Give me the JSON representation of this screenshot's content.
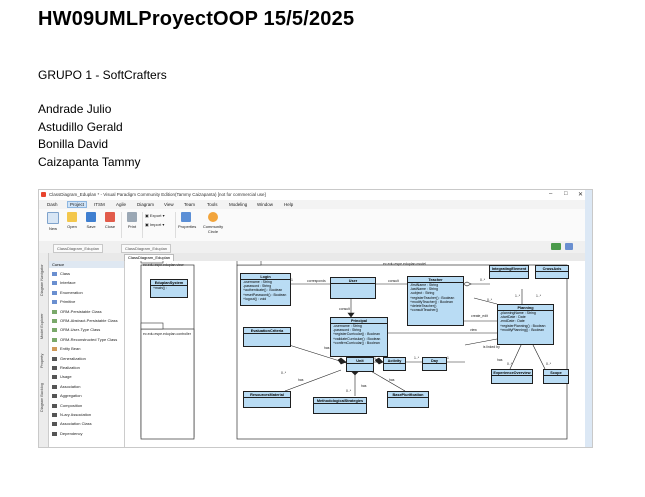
{
  "document": {
    "title": "HW09UMLProyectOOP  15/5/2025",
    "group": "GRUPO 1 - SoftCrafters",
    "members": [
      "Andrade Julio",
      "Astudillo Gerald",
      "Bonilla David",
      "Caizapanta Tammy"
    ]
  },
  "screenshot": {
    "window_title": "ClassDiagram_Eduplan * - Visual Paradigm Community Edition(Tammy Caizapanta) [not for commercial use]",
    "menu": [
      "Dash",
      "Project",
      "ITSM",
      "Agile",
      "Diagram",
      "View",
      "Team",
      "Tools",
      "Modeling",
      "Window",
      "Help"
    ],
    "active_menu": "Project",
    "ribbon": {
      "new": "New",
      "open": "Open",
      "save": "Save",
      "close": "Close",
      "print": "Print",
      "export": "Export",
      "import": "Import",
      "properties": "Properties",
      "community": "Community Circle"
    },
    "breadcrumbs": [
      "ClassDiagram_Eduplan",
      "ClassDiagram_Eduplan"
    ],
    "tab": "ClassDiagram_Eduplan",
    "side_tabs": [
      "Diagram Navigator",
      "Model Explorer",
      "Property",
      "Diagram Backlog"
    ],
    "palette": {
      "header": "Cursor",
      "items": [
        "Class",
        "Interface",
        "Enumeration",
        "Primitive",
        "ORM-Persistable Class",
        "ORM-Abstract-Persistable Class",
        "ORM-User-Type Class",
        "ORM-Reconstructed Type Class",
        "Entity Bean",
        "Generalization",
        "Realization",
        "Usage",
        "Association",
        "Aggregation",
        "Composition",
        "N-ary Association",
        "Association Class",
        "Dependency"
      ]
    },
    "diagram": {
      "package_main": "ec.edu.espe.eduplan.model",
      "package_view": "ec.edu.espe.eduplan.view",
      "package_controller": "ec.edu.espe.eduplan.controller",
      "classes": {
        "eduplan_system": {
          "name": "EduplanSystem",
          "attrs": [
            "+main() : "
          ]
        },
        "login": {
          "name": "Login",
          "attrs": [
            "-username : String",
            "-password : String",
            "+authenticate() : Boolean",
            "+resetPassword() : Boolean",
            "+logout() : void"
          ]
        },
        "user": {
          "name": "User",
          "attrs": []
        },
        "teacher": {
          "name": "Teacher",
          "attrs": [
            "-firstName : String",
            "-lastName : String",
            "-subject : String",
            "+registerTeacher() : Boolean",
            "+modifyTeacher() : Boolean",
            "+deleteTeacher()",
            "+consultTeacher()"
          ]
        },
        "integrating_element": {
          "name": "IntegratingElement",
          "attrs": []
        },
        "cross_axis": {
          "name": "CrossAxis",
          "attrs": []
        },
        "planning": {
          "name": "Planning",
          "attrs": [
            "-planningName : String",
            "-startDate : Date",
            "-endDate : Date",
            "+registerPlanning() : Boolean",
            "+modifyPlanning() : Boolean"
          ]
        },
        "principal": {
          "name": "Principal",
          "attrs": [
            "-username : String",
            "-password : String",
            "+registerCurricular() : Boolean",
            "+validateCurricular() : Boolean",
            "+confirmCurricular() : Boolean"
          ]
        },
        "evaluation_criteria": {
          "name": "EvaluationCriteria",
          "attrs": []
        },
        "unit": {
          "name": "Unit",
          "attrs": []
        },
        "activity": {
          "name": "Activity",
          "attrs": []
        },
        "day": {
          "name": "Day",
          "attrs": []
        },
        "experience_overview": {
          "name": "ExperienceOverview",
          "attrs": []
        },
        "scope": {
          "name": "Scope",
          "attrs": []
        },
        "resources_material": {
          "name": "ResourcesMaterial",
          "attrs": []
        },
        "methodological_strategies": {
          "name": "MethodologicalStrategies",
          "attrs": []
        },
        "base_plurification": {
          "name": "BasePlurification",
          "attrs": []
        }
      },
      "labels": {
        "corresponds": "corresponds",
        "consult": "consult",
        "create_edit": "create_edit",
        "view": "view",
        "is_linked_by": "is linked by",
        "has": "has",
        "one": "1",
        "many": "0..*",
        "one_many": "1..*"
      }
    }
  }
}
